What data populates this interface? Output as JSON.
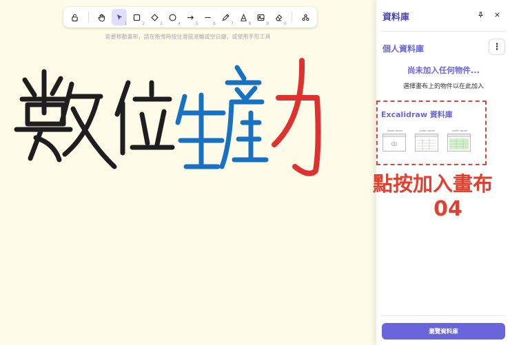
{
  "toolbar": {
    "tools": [
      {
        "icon": "lock-icon",
        "key": ""
      },
      {
        "icon": "hand-icon",
        "key": ""
      },
      {
        "icon": "pointer-icon",
        "key": "1"
      },
      {
        "icon": "rectangle-icon",
        "key": "2"
      },
      {
        "icon": "diamond-icon",
        "key": "3"
      },
      {
        "icon": "ellipse-icon",
        "key": "4"
      },
      {
        "icon": "arrow-icon",
        "key": "5"
      },
      {
        "icon": "line-icon",
        "key": "6"
      },
      {
        "icon": "pencil-icon",
        "key": "7"
      },
      {
        "icon": "text-icon",
        "key": "8"
      },
      {
        "icon": "image-icon",
        "key": "9"
      },
      {
        "icon": "eraser-icon",
        "key": "0"
      },
      {
        "icon": "shapes-icon",
        "key": ""
      }
    ],
    "active_tool": "pointer-icon"
  },
  "canvas": {
    "hint": "若要移動畫布，請在拖曳時按住滑鼠滾輪或空白鍵，或使用手形工具",
    "handwriting_colors": {
      "black": "#1e1e1e",
      "blue": "#1971c2",
      "red": "#e03131"
    }
  },
  "library": {
    "title": "資料庫",
    "personal_title": "個人資料庫",
    "more_label": "⋮",
    "empty_title": "尚未加入任何物件...",
    "empty_subtitle": "選擇畫布上的物件以在此加入",
    "excalidraw_title": "Excalidraw 資料庫",
    "thumbnails": [
      "Lorem ipsum",
      "Lorem ipsum",
      "Lorem ipsum"
    ],
    "browse_label": "瀏覽資料庫"
  },
  "annotation": {
    "line1": "點按加入畫布",
    "line2": "04",
    "color": "#e43f2e"
  },
  "colors": {
    "accent": "#6965db",
    "canvas_bg": "#fffbe9"
  }
}
